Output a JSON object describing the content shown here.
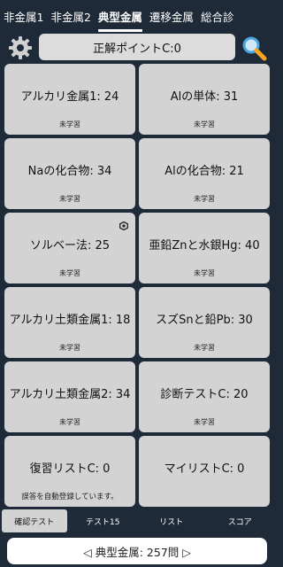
{
  "tabs": [
    {
      "label": "非金属1",
      "active": false
    },
    {
      "label": "非金属2",
      "active": false
    },
    {
      "label": "典型金属",
      "active": true
    },
    {
      "label": "遷移金属",
      "active": false
    },
    {
      "label": "総合診",
      "active": false
    }
  ],
  "header": {
    "points_label": "正解ポイントC:0",
    "settings_icon": "gear-icon",
    "search_icon": "search-icon"
  },
  "cards": [
    {
      "title": "アルカリ金属1: 24",
      "status": "未学習"
    },
    {
      "title": "Alの単体: 31",
      "status": "未学習"
    },
    {
      "title": "Naの化合物: 34",
      "status": "未学習"
    },
    {
      "title": "Alの化合物: 21",
      "status": "未学習"
    },
    {
      "title": "ソルベー法: 25",
      "status": "未学習",
      "badge": "hexagon-icon"
    },
    {
      "title": "亜鉛Znと水銀Hg: 40",
      "status": "未学習"
    },
    {
      "title": "アルカリ土類金属1: 18",
      "status": "未学習"
    },
    {
      "title": "スズSnと鉛Pb: 30",
      "status": "未学習"
    },
    {
      "title": "アルカリ土類金属2: 34",
      "status": "未学習"
    },
    {
      "title": "診断テストC: 20",
      "status": "未学習"
    },
    {
      "title": "復習リストC: 0",
      "note": "誤答を自動登録しています。"
    },
    {
      "title": "マイリストC: 0",
      "status": ""
    }
  ],
  "bottom_nav": [
    {
      "label": "確認テスト",
      "active": true
    },
    {
      "label": "テスト15",
      "active": false
    },
    {
      "label": "リスト",
      "active": false
    },
    {
      "label": "スコア",
      "active": false
    }
  ],
  "footer": {
    "label": "◁ 典型金属: 257問 ▷"
  },
  "colors": {
    "background": "#1f2a38",
    "card": "#d3d3d3",
    "search_accent": "#f5a623"
  }
}
